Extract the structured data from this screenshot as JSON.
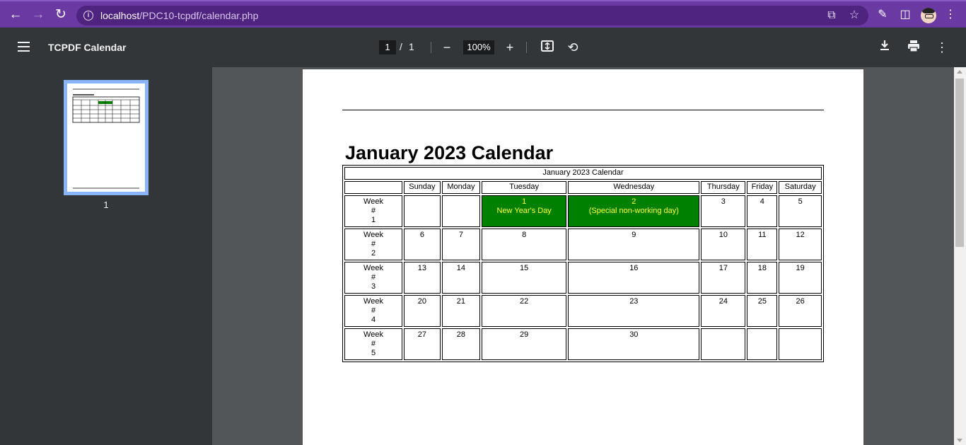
{
  "browser": {
    "url_host": "localhost",
    "url_path": "/PDC10-tcpdf/calendar.php",
    "accent_color": "#6a3aa2"
  },
  "pdf_toolbar": {
    "title": "TCPDF Calendar",
    "current_page": "1",
    "page_separator": "/",
    "total_pages": "1",
    "zoom": "100%"
  },
  "sidebar": {
    "thumbnail_label": "1"
  },
  "calendar": {
    "heading": "January 2023 Calendar",
    "table_caption": "January 2023 Calendar",
    "weekdays": [
      "Sunday",
      "Monday",
      "Tuesday",
      "Wednesday",
      "Thursday",
      "Friday",
      "Saturday"
    ],
    "week_label": "Week",
    "week_hash": "#",
    "holiday_color": "#008000",
    "holiday_text_color": "#ffff33",
    "weeks": [
      {
        "number": "1",
        "days": [
          {
            "day": "",
            "note": "",
            "holiday": false
          },
          {
            "day": "",
            "note": "",
            "holiday": false
          },
          {
            "day": "1",
            "note": "New Year's Day",
            "holiday": true
          },
          {
            "day": "2",
            "note": "(Special non-working day)",
            "holiday": true
          },
          {
            "day": "3",
            "note": "",
            "holiday": false
          },
          {
            "day": "4",
            "note": "",
            "holiday": false
          },
          {
            "day": "5",
            "note": "",
            "holiday": false
          }
        ]
      },
      {
        "number": "2",
        "days": [
          {
            "day": "6",
            "note": "",
            "holiday": false
          },
          {
            "day": "7",
            "note": "",
            "holiday": false
          },
          {
            "day": "8",
            "note": "",
            "holiday": false
          },
          {
            "day": "9",
            "note": "",
            "holiday": false
          },
          {
            "day": "10",
            "note": "",
            "holiday": false
          },
          {
            "day": "11",
            "note": "",
            "holiday": false
          },
          {
            "day": "12",
            "note": "",
            "holiday": false
          }
        ]
      },
      {
        "number": "3",
        "days": [
          {
            "day": "13",
            "note": "",
            "holiday": false
          },
          {
            "day": "14",
            "note": "",
            "holiday": false
          },
          {
            "day": "15",
            "note": "",
            "holiday": false
          },
          {
            "day": "16",
            "note": "",
            "holiday": false
          },
          {
            "day": "17",
            "note": "",
            "holiday": false
          },
          {
            "day": "18",
            "note": "",
            "holiday": false
          },
          {
            "day": "19",
            "note": "",
            "holiday": false
          }
        ]
      },
      {
        "number": "4",
        "days": [
          {
            "day": "20",
            "note": "",
            "holiday": false
          },
          {
            "day": "21",
            "note": "",
            "holiday": false
          },
          {
            "day": "22",
            "note": "",
            "holiday": false
          },
          {
            "day": "23",
            "note": "",
            "holiday": false
          },
          {
            "day": "24",
            "note": "",
            "holiday": false
          },
          {
            "day": "25",
            "note": "",
            "holiday": false
          },
          {
            "day": "26",
            "note": "",
            "holiday": false
          }
        ]
      },
      {
        "number": "5",
        "days": [
          {
            "day": "27",
            "note": "",
            "holiday": false
          },
          {
            "day": "28",
            "note": "",
            "holiday": false
          },
          {
            "day": "29",
            "note": "",
            "holiday": false
          },
          {
            "day": "30",
            "note": "",
            "holiday": false
          },
          {
            "day": "",
            "note": "",
            "holiday": false
          },
          {
            "day": "",
            "note": "",
            "holiday": false
          },
          {
            "day": "",
            "note": "",
            "holiday": false
          }
        ]
      }
    ]
  }
}
